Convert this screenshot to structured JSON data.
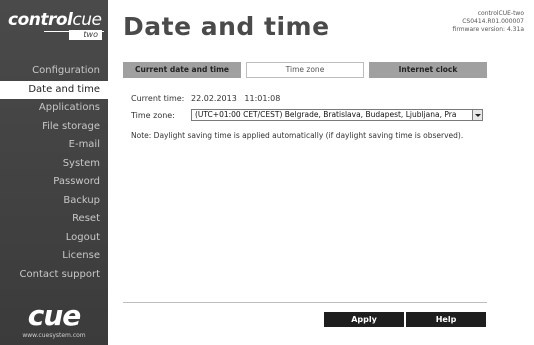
{
  "sidebar": {
    "logo": {
      "brand_bold": "control",
      "brand_thin": "cue",
      "sub": "two"
    },
    "items": [
      {
        "label": "Configuration"
      },
      {
        "label": "Date and time"
      },
      {
        "label": "Applications"
      },
      {
        "label": "File storage"
      },
      {
        "label": "E-mail"
      },
      {
        "label": "System"
      },
      {
        "label": "Password"
      },
      {
        "label": "Backup"
      },
      {
        "label": "Reset"
      },
      {
        "label": "Logout"
      },
      {
        "label": "License"
      },
      {
        "label": "Contact support"
      }
    ],
    "active_index": 1,
    "footer": {
      "logo": "cue",
      "url": "www.cuesystem.com"
    }
  },
  "header": {
    "title": "Date and time",
    "device": {
      "name": "controlCUE-two",
      "code": "CS0414.R01.000007",
      "firmware": "firmware version: 4.31a"
    }
  },
  "tabs": [
    {
      "label": "Current date and time",
      "active": false
    },
    {
      "label": "Time zone",
      "active": true
    },
    {
      "label": "Internet clock",
      "active": false
    }
  ],
  "current_time": {
    "label": "Current time:",
    "value": "22.02.2013   11:01:08"
  },
  "timezone": {
    "label": "Time zone:",
    "selected": "(UTC+01:00 CET/CEST) Belgrade, Bratislava, Budapest, Ljubljana, Pra"
  },
  "note": "Note: Daylight saving time is applied automatically (if daylight saving time is observed).",
  "buttons": {
    "apply": "Apply",
    "help": "Help"
  },
  "colors": {
    "sidebar_bg": "#404040",
    "tab_inactive": "#a0a0a0",
    "button_bg": "#1e1e1e"
  }
}
